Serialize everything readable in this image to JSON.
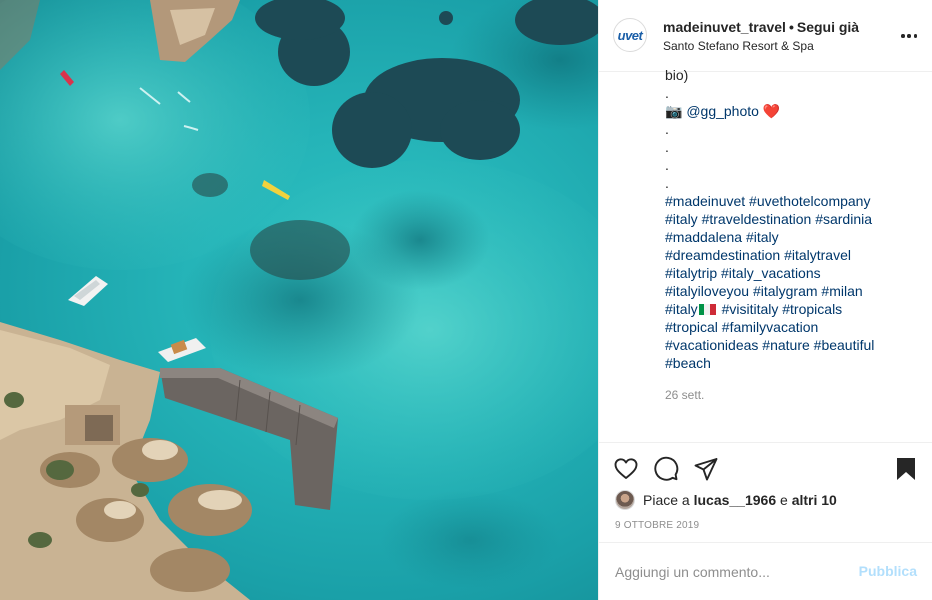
{
  "photo": {
    "alt_icon": "aerial-photo"
  },
  "header": {
    "logo_text": "uvet",
    "username": "madeinuvet_travel",
    "separator": "•",
    "follow_label": "Segui già",
    "location": "Santo Stefano Resort & Spa"
  },
  "caption": {
    "first_line": "bio)",
    "dot": ".",
    "camera_icon": "📷",
    "mention": "@gg_photo",
    "heart": "❤️",
    "hashtag_lines": [
      "#madeinuvet #uvethotelcompany",
      "#italy #traveldestination #sardinia",
      "#maddalena #italy",
      "#dreamdestination #italytravel",
      "#italytrip #italy_vacations",
      "#italyiloveyou #italygram #milan",
      "#italy",
      "#visititaly #tropicals",
      "#tropical #familyvacation",
      "#vacationideas #nature #beautiful",
      "#beach"
    ],
    "relative_date": "26 sett."
  },
  "likes": {
    "prefix": "Piace a",
    "user": "lucas__1966",
    "conjunction": "e",
    "others": "altri 10"
  },
  "post_date": "9 OTTOBRE 2019",
  "comment": {
    "placeholder": "Aggiungi un commento...",
    "publish_label": "Pubblica"
  },
  "colors": {
    "text": "#262626",
    "link": "#00376b",
    "muted": "#8e8e8e",
    "publish_disabled": "#b2dffc",
    "sea": "#25b4b8"
  }
}
